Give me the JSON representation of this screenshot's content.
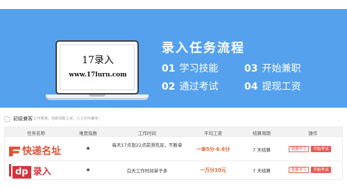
{
  "banner": {
    "laptop_title": "17录入",
    "laptop_url": "www.17luru.com",
    "flow_title": "录入任务流程",
    "steps": [
      {
        "num": "01",
        "label": "学习技能"
      },
      {
        "num": "02",
        "label": "通过考试"
      },
      {
        "num": "03",
        "label": "开始兼职"
      },
      {
        "num": "04",
        "label": "提现工资"
      }
    ]
  },
  "section": {
    "name": "初级兼客",
    "desc": "工作简单，自助领取工资，人人均可兼专！"
  },
  "table": {
    "headers": [
      "任务名称",
      "难度指数",
      "工作时间",
      "平均工资",
      "结算周期",
      "操作"
    ],
    "rows": [
      {
        "name": "快递名址",
        "difficulty": "★",
        "time": "每天17点到22点前滑充足，不断单",
        "pay": "一单5分-6.6分",
        "cycle": "7 天结算",
        "btn_learn": "我要学习",
        "btn_exam": "开始考试"
      },
      {
        "name_prefix": "dp",
        "name": "录入",
        "difficulty": "★",
        "time": "白天工作时间单子多",
        "pay": "一万分10元",
        "cycle": "7 天结算",
        "btn_learn": "我要学习",
        "btn_exam": "开始考试"
      }
    ]
  },
  "colors": {
    "banner_bg": "#55a1ee",
    "accent_red": "#e65b4f",
    "pay_orange": "#e0622b"
  }
}
